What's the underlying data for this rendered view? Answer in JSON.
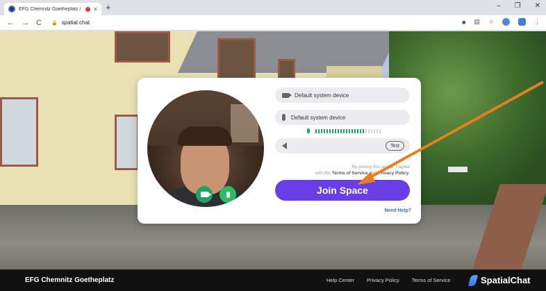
{
  "browser": {
    "tab_title": "EFG Chemnitz Goetheplatz / ",
    "tab_close": "×",
    "new_tab": "+",
    "window_controls": [
      "–",
      "❐",
      "✕"
    ],
    "nav": {
      "back": "←",
      "forward": "→",
      "reload": "C"
    },
    "url": "spatial.chat"
  },
  "modal": {
    "camera_device": "Default system device",
    "mic_device": "Default system device",
    "mic_level": {
      "active_bars": 18,
      "total_bars": 24
    },
    "speaker_test_label": "Test",
    "terms_line1": "By joining this space, I agree",
    "terms_prefix": "with the ",
    "terms_tos": "Terms of Service",
    "terms_and": " and ",
    "terms_privacy": "Privacy Policy",
    "terms_suffix": ".",
    "join_label": "Join Space",
    "help_label": "Need Help?"
  },
  "footer": {
    "space_name": "EFG Chemnitz Goetheplatz",
    "links": [
      "Help Center",
      "Privacy Policy",
      "Terms of Service"
    ],
    "brand": "SpatialChat"
  },
  "colors": {
    "accent": "#6a3ee6",
    "green": "#21a366",
    "arrow": "#e67e22"
  }
}
